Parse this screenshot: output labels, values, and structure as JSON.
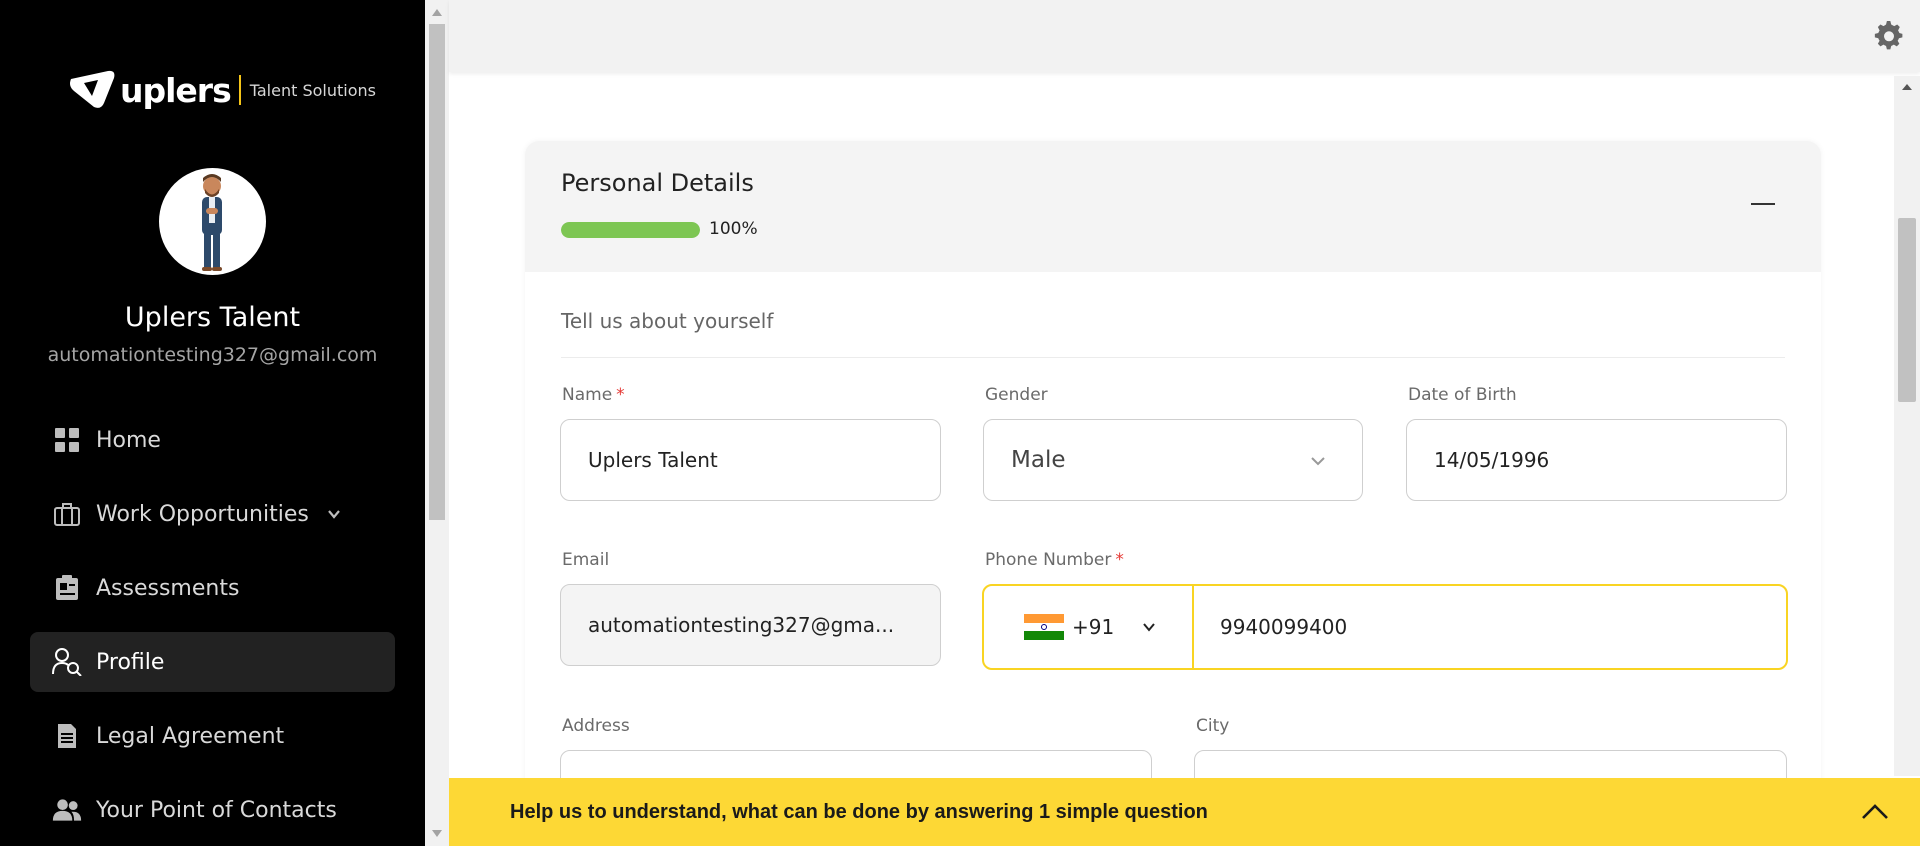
{
  "brand": {
    "name": "uplers",
    "tagline": "Talent Solutions"
  },
  "user": {
    "name": "Uplers Talent",
    "email": "automationtesting327@gmail.com"
  },
  "nav": {
    "items": [
      {
        "label": "Home",
        "icon": "grid-icon"
      },
      {
        "label": "Work Opportunities",
        "icon": "briefcase-icon"
      },
      {
        "label": "Assessments",
        "icon": "assessment-icon"
      },
      {
        "label": "Profile",
        "icon": "profile-search-icon",
        "active": true
      },
      {
        "label": "Legal Agreement",
        "icon": "document-icon"
      },
      {
        "label": "Your Point of Contacts",
        "icon": "contacts-icon"
      }
    ]
  },
  "section": {
    "title": "Personal Details",
    "progress_percent": 100,
    "progress_label": "100%",
    "subtitle": "Tell us about yourself"
  },
  "form": {
    "name_label": "Name",
    "name_required": "*",
    "name_value": "Uplers Talent",
    "gender_label": "Gender",
    "gender_value": "Male",
    "dob_label": "Date of Birth",
    "dob_value": "14/05/1996",
    "email_label": "Email",
    "email_value": "automationtesting327@gma...",
    "phone_label": "Phone Number",
    "phone_required": "*",
    "phone_country_code": "+91",
    "phone_value": "9940099400",
    "address_label": "Address",
    "city_label": "City"
  },
  "banner": {
    "text": "Help us to understand, what can be done by answering 1 simple question"
  },
  "colors": {
    "sidebar_bg": "#000000",
    "accent_yellow": "#fdd835",
    "progress_green": "#7dc653",
    "required_red": "#e53935"
  }
}
